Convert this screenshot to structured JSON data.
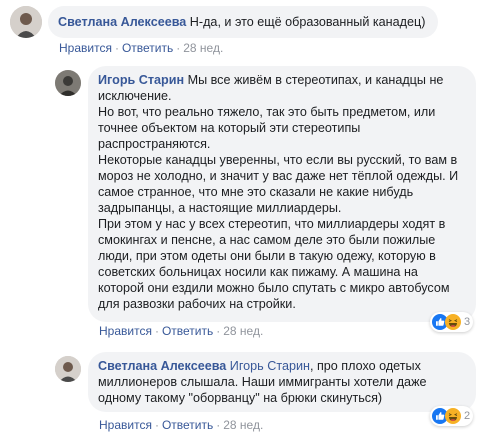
{
  "comments": [
    {
      "author": "Светлана Алексеева",
      "mention": "",
      "text_lines": [
        "Н-да, и это ещё образованный канадец)"
      ],
      "actions": {
        "like": "Нравится",
        "reply": "Ответить",
        "time": "28 нед."
      },
      "reactions": null,
      "colors": {
        "avatar_bg": "#c7c2be",
        "avatar_fg": "#6e5a4d"
      }
    },
    {
      "author": "Игорь Старин",
      "mention": "",
      "text_lines": [
        "Мы все живём в стереотипах, и канадцы не",
        "исключение.",
        "Но вот, что реально тяжело, так это быть предметом, или",
        "точнее объектом на который эти стереотипы",
        "распространяются.",
        "Некоторые канадцы уверенны, что если вы русский, то вам в",
        "мороз не холодно, и значит у вас даже нет тёплой одежды. И",
        "самое странное, что мне это сказали не какие нибудь",
        "задрыпанцы, а настоящие миллиардеры.",
        "При этом у нас у всех стереотип, что миллиардеры ходят в",
        "смокингах и пенсне, а нас самом деле это были пожилые",
        "люди, при этом одеты они были в такую одежу, которую в",
        "советских больницах носили как пижаму. А машина на",
        "которой они ездили можно было спутать с микро автобусом",
        "для развозки рабочих на стройки."
      ],
      "actions": {
        "like": "Нравится",
        "reply": "Ответить",
        "time": "28 нед."
      },
      "reactions": {
        "icons": [
          "like-icon",
          "haha-icon"
        ],
        "count": "3"
      },
      "colors": {
        "avatar_bg": "#7d7a74",
        "avatar_fg": "#3b3a37"
      }
    },
    {
      "author": "Светлана Алексеева",
      "mention": "Игорь Старин",
      "text_lines": [
        ", про плохо одетых",
        "миллионеров слышала. Наши иммигранты хотели даже",
        "одному такому \"оборванцу\" на брюки скинуться)"
      ],
      "actions": {
        "like": "Нравится",
        "reply": "Ответить",
        "time": "28 нед."
      },
      "reactions": {
        "icons": [
          "like-icon",
          "haha-icon"
        ],
        "count": "2"
      },
      "colors": {
        "avatar_bg": "#c7c2be",
        "avatar_fg": "#6e5a4d"
      }
    }
  ],
  "colors": {
    "link": "#385898",
    "bubble": "#f2f3f5",
    "meta": "#90949c",
    "like": "#1877f2",
    "haha": "#f7b125"
  }
}
